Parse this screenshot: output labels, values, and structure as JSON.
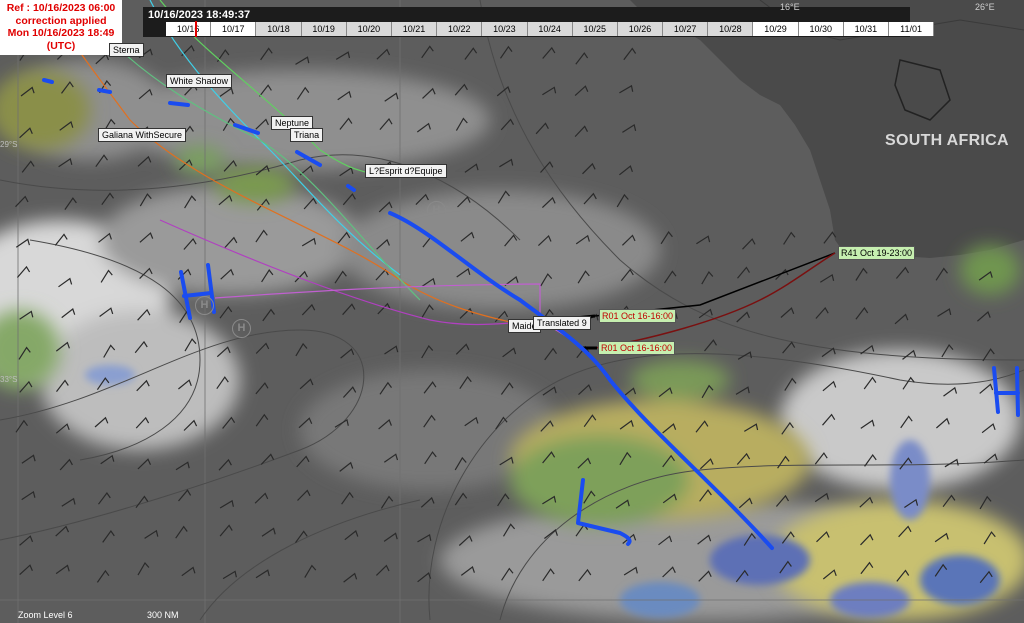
{
  "reference": {
    "line1": "Ref : 10/16/2023 06:00",
    "line2": "correction applied",
    "line3": "Mon 10/16/2023 18:49",
    "line4": "(UTC)"
  },
  "timebar": {
    "current_time": "10/16/2023 18:49:37",
    "days": [
      "10/16",
      "10/17",
      "10/18",
      "10/19",
      "10/20",
      "10/21",
      "10/22",
      "10/23",
      "10/24",
      "10/25",
      "10/26",
      "10/27",
      "10/28",
      "10/29",
      "10/30",
      "10/31",
      "11/01"
    ]
  },
  "boats": {
    "sterna": "Sterna",
    "white_shadow": "White Shadow",
    "neptune": "Neptune",
    "triana": "Triana",
    "galiana": "Galiana WithSecure",
    "esprit": "L?Esprit d?Equipe",
    "maiden": "Maide",
    "translated": "Translated 9"
  },
  "routes": {
    "r01_a": "R01 Oct 16-16:00",
    "r01_b": "R01 Oct 16-16:00",
    "r41": "R41 Oct 19-23:00"
  },
  "map": {
    "country": "SOUTH AFRICA",
    "lon_labels": [
      "16°E",
      "26°E"
    ],
    "lat_labels": [
      "29°S",
      "33°S"
    ],
    "high_marker": "H"
  },
  "footer": {
    "zoom": "Zoom Level 6",
    "scale": "300 NM"
  }
}
